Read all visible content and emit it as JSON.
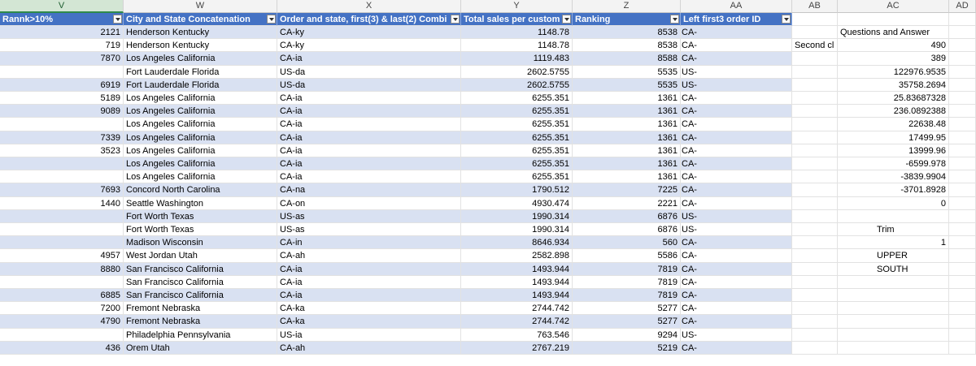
{
  "columns": [
    "V",
    "W",
    "X",
    "Y",
    "Z",
    "AA",
    "AB",
    "AC",
    "AD"
  ],
  "selected_column": "V",
  "headers": [
    "Rannk>10%",
    "City and State Concatenation",
    "Order and state, first(3) & last(2) Combi",
    "Total sales per custom",
    "Ranking",
    "Left first3 order ID"
  ],
  "rows": [
    [
      "2121",
      "Henderson Kentucky",
      "CA-ky",
      "1148.78",
      "8538",
      "CA-"
    ],
    [
      "719",
      "Henderson Kentucky",
      "CA-ky",
      "1148.78",
      "8538",
      "CA-"
    ],
    [
      "7870",
      "Los Angeles California",
      "CA-ia",
      "1119.483",
      "8588",
      "CA-"
    ],
    [
      "",
      "Fort Lauderdale Florida",
      "US-da",
      "2602.5755",
      "5535",
      "US-"
    ],
    [
      "6919",
      "Fort Lauderdale Florida",
      "US-da",
      "2602.5755",
      "5535",
      "US-"
    ],
    [
      "5189",
      "Los Angeles California",
      "CA-ia",
      "6255.351",
      "1361",
      "CA-"
    ],
    [
      "9089",
      "Los Angeles California",
      "CA-ia",
      "6255.351",
      "1361",
      "CA-"
    ],
    [
      "",
      "Los Angeles California",
      "CA-ia",
      "6255.351",
      "1361",
      "CA-"
    ],
    [
      "7339",
      "Los Angeles California",
      "CA-ia",
      "6255.351",
      "1361",
      "CA-"
    ],
    [
      "3523",
      "Los Angeles California",
      "CA-ia",
      "6255.351",
      "1361",
      "CA-"
    ],
    [
      "",
      "Los Angeles California",
      "CA-ia",
      "6255.351",
      "1361",
      "CA-"
    ],
    [
      "",
      "Los Angeles California",
      "CA-ia",
      "6255.351",
      "1361",
      "CA-"
    ],
    [
      "7693",
      "Concord North Carolina",
      "CA-na",
      "1790.512",
      "7225",
      "CA-"
    ],
    [
      "1440",
      "Seattle Washington",
      "CA-on",
      "4930.474",
      "2221",
      "CA-"
    ],
    [
      "",
      "Fort Worth Texas",
      "US-as",
      "1990.314",
      "6876",
      "US-"
    ],
    [
      "",
      "Fort Worth Texas",
      "US-as",
      "1990.314",
      "6876",
      "US-"
    ],
    [
      "",
      "Madison Wisconsin",
      "CA-in",
      "8646.934",
      "560",
      "CA-"
    ],
    [
      "4957",
      "West Jordan Utah",
      "CA-ah",
      "2582.898",
      "5586",
      "CA-"
    ],
    [
      "8880",
      "San Francisco California",
      "CA-ia",
      "1493.944",
      "7819",
      "CA-"
    ],
    [
      "",
      "San Francisco California",
      "CA-ia",
      "1493.944",
      "7819",
      "CA-"
    ],
    [
      "6885",
      "San Francisco California",
      "CA-ia",
      "1493.944",
      "7819",
      "CA-"
    ],
    [
      "7200",
      "Fremont Nebraska",
      "CA-ka",
      "2744.742",
      "5277",
      "CA-"
    ],
    [
      "4790",
      "Fremont Nebraska",
      "CA-ka",
      "2744.742",
      "5277",
      "CA-"
    ],
    [
      "",
      "Philadelphia Pennsylvania",
      "US-ia",
      "763.546",
      "9294",
      "US-"
    ],
    [
      "436",
      "Orem Utah",
      "CA-ah",
      "2767.219",
      "5219",
      "CA-"
    ]
  ],
  "side": [
    [
      "",
      "Questions and Answer"
    ],
    [
      "Second cl",
      "490"
    ],
    [
      "",
      "389"
    ],
    [
      "",
      "122976.9535"
    ],
    [
      "",
      "35758.2694"
    ],
    [
      "",
      "25.83687328"
    ],
    [
      "",
      "236.0892388"
    ],
    [
      "",
      "22638.48"
    ],
    [
      "",
      "17499.95"
    ],
    [
      "",
      "13999.96"
    ],
    [
      "",
      "-6599.978"
    ],
    [
      "",
      "-3839.9904"
    ],
    [
      "",
      "-3701.8928"
    ],
    [
      "",
      "0"
    ],
    [
      "",
      ""
    ],
    [
      "",
      "Trim"
    ],
    [
      "",
      "1"
    ],
    [
      "",
      "UPPER"
    ],
    [
      "",
      "SOUTH"
    ],
    [
      "",
      ""
    ],
    [
      "",
      ""
    ],
    [
      "",
      ""
    ],
    [
      "",
      ""
    ],
    [
      "",
      ""
    ],
    [
      "",
      ""
    ]
  ],
  "colors": {
    "header_bg": "#4472c4",
    "band_bg": "#d9e1f2",
    "selected_col_bg": "#d3e6d4"
  }
}
